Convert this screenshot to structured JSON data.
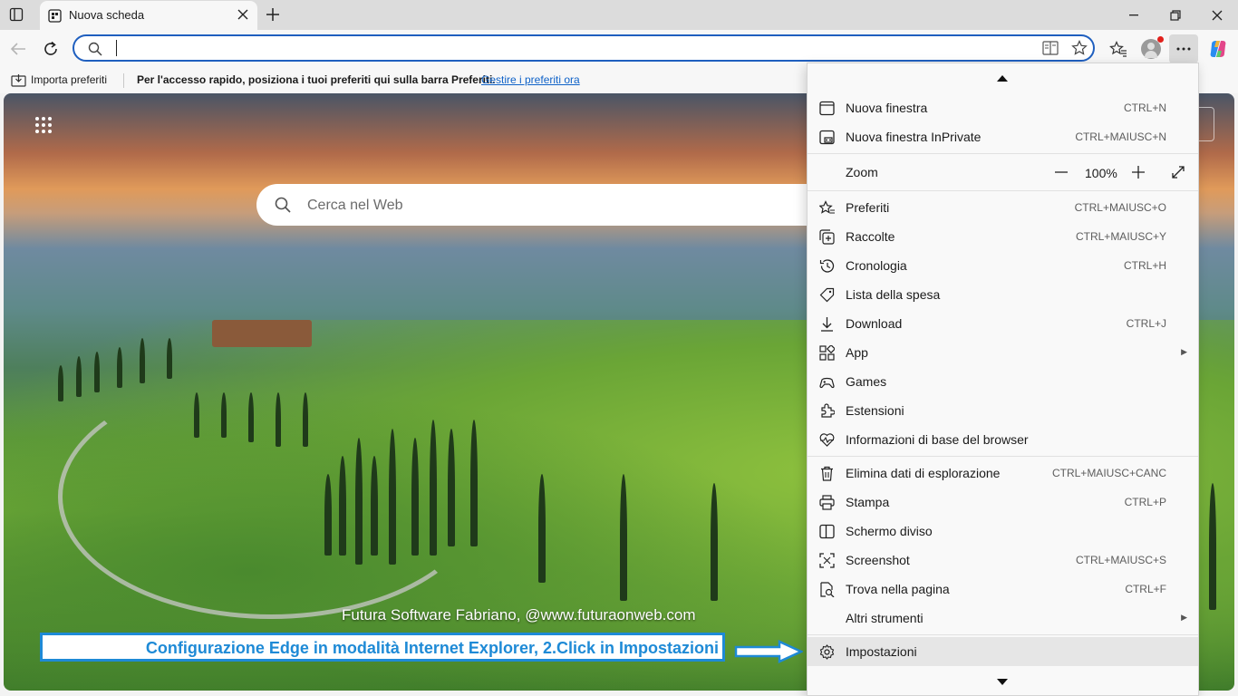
{
  "tab": {
    "title": "Nuova scheda"
  },
  "address": {
    "value": ""
  },
  "favbar": {
    "import_label": "Importa preferiti",
    "message": "Per l'accesso rapido, posiziona i tuoi preferiti qui sulla barra Preferiti.",
    "link": "Gestire i preferiti ora"
  },
  "newtab": {
    "search_placeholder": "Cerca nel Web",
    "credit": "Futura Software Fabriano, @www.futuraonweb.com",
    "caption": "Configurazione Edge in modalità Internet Explorer, 2.Click in Impostazioni"
  },
  "menu": {
    "items": [
      {
        "label": "Nuova finestra",
        "shortcut": "CTRL+N",
        "icon": "window-icon"
      },
      {
        "label": "Nuova finestra InPrivate",
        "shortcut": "CTRL+MAIUSC+N",
        "icon": "inprivate-icon"
      },
      {
        "label": "Zoom",
        "icon": ""
      },
      {
        "label": "Preferiti",
        "shortcut": "CTRL+MAIUSC+O",
        "icon": "favorites-icon"
      },
      {
        "label": "Raccolte",
        "shortcut": "CTRL+MAIUSC+Y",
        "icon": "collections-icon"
      },
      {
        "label": "Cronologia",
        "shortcut": "CTRL+H",
        "icon": "history-icon"
      },
      {
        "label": "Lista della spesa",
        "icon": "tag-icon"
      },
      {
        "label": "Download",
        "shortcut": "CTRL+J",
        "icon": "download-icon"
      },
      {
        "label": "App",
        "icon": "apps-icon"
      },
      {
        "label": "Games",
        "icon": "games-icon"
      },
      {
        "label": "Estensioni",
        "icon": "extensions-icon"
      },
      {
        "label": "Informazioni di base del browser",
        "icon": "heart-pulse-icon"
      },
      {
        "label": "Elimina dati di esplorazione",
        "shortcut": "CTRL+MAIUSC+CANC",
        "icon": "trash-icon"
      },
      {
        "label": "Stampa",
        "shortcut": "CTRL+P",
        "icon": "print-icon"
      },
      {
        "label": "Schermo diviso",
        "icon": "split-screen-icon"
      },
      {
        "label": "Screenshot",
        "shortcut": "CTRL+MAIUSC+S",
        "icon": "screenshot-icon"
      },
      {
        "label": "Trova nella pagina",
        "shortcut": "CTRL+F",
        "icon": "find-icon"
      },
      {
        "label": "Altri strumenti",
        "icon": ""
      },
      {
        "label": "Impostazioni",
        "icon": "gear-icon"
      }
    ],
    "zoom": {
      "value": "100%"
    }
  }
}
